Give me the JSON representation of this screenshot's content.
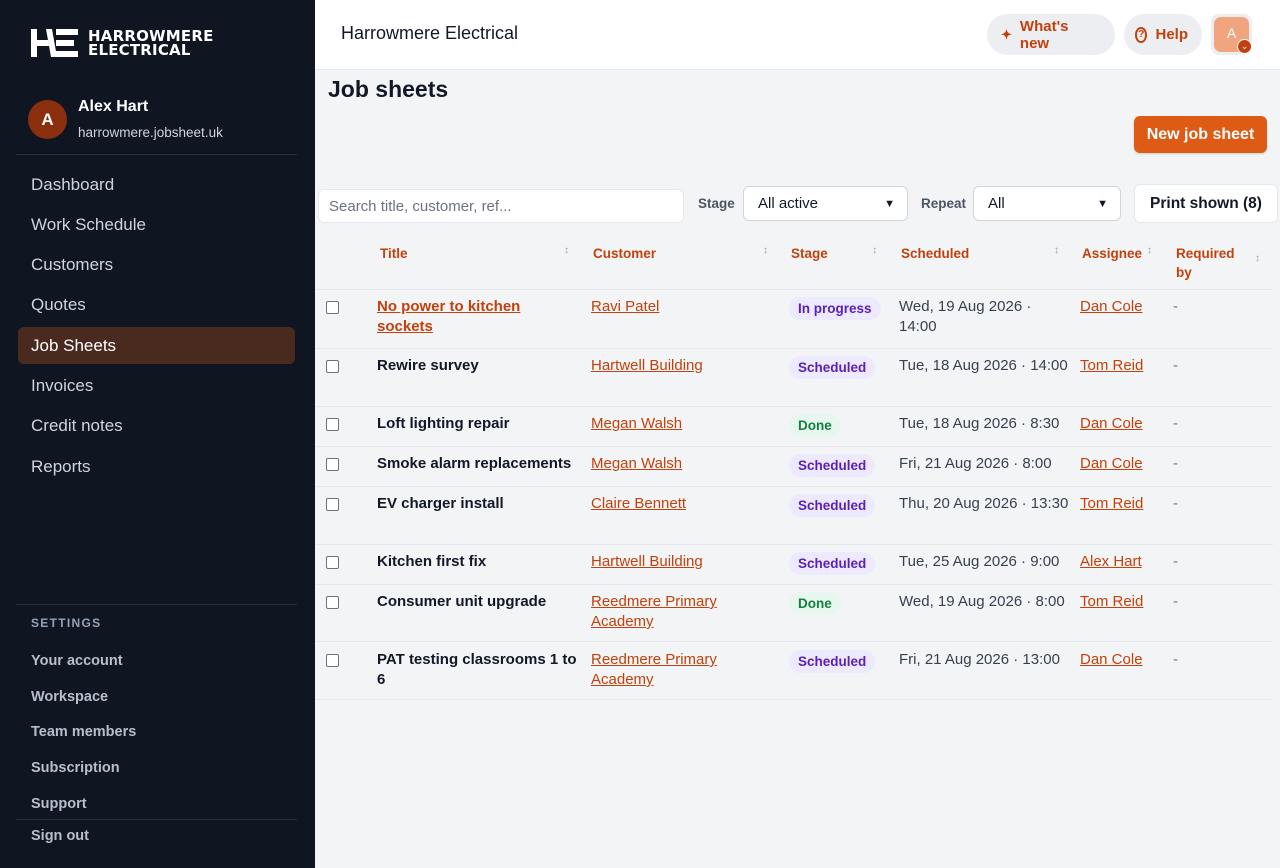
{
  "brand": {
    "line1": "HARROWMERE",
    "line2": "ELECTRICAL",
    "mark": "HE"
  },
  "user": {
    "initial": "A",
    "name": "Alex Hart",
    "domain": "harrowmere.jobsheet.uk"
  },
  "nav": [
    {
      "label": "Dashboard"
    },
    {
      "label": "Work Schedule"
    },
    {
      "label": "Customers"
    },
    {
      "label": "Quotes"
    },
    {
      "label": "Job Sheets",
      "active": true
    },
    {
      "label": "Invoices"
    },
    {
      "label": "Credit notes"
    },
    {
      "label": "Reports"
    }
  ],
  "settings": {
    "heading": "SETTINGS",
    "items": [
      "Your account",
      "Workspace",
      "Team members",
      "Subscription",
      "Support"
    ],
    "signout": "Sign out"
  },
  "topbar": {
    "title": "Harrowmere Electrical",
    "whats_new": "What's new",
    "help": "Help",
    "account_initial": "A"
  },
  "page": {
    "title": "Job sheets",
    "new_button": "New job sheet",
    "search_placeholder": "Search title, customer, ref...",
    "stage_label": "Stage",
    "stage_value": "All active",
    "repeat_label": "Repeat",
    "repeat_value": "All",
    "print_button": "Print shown (8)"
  },
  "table": {
    "columns": [
      "Title",
      "Customer",
      "Stage",
      "Scheduled",
      "Assignee",
      "Required by"
    ],
    "rows": [
      {
        "title": "No power to kitchen sockets",
        "customer": "Ravi Patel",
        "stage": "In progress",
        "scheduled": "Wed, 19 Aug 2026 · 14:00",
        "assignee": "Dan Cole",
        "required": "-"
      },
      {
        "title": "Rewire survey",
        "customer": "Hartwell Building",
        "stage": "Scheduled",
        "scheduled": "Tue, 18 Aug 2026 · 14:00",
        "assignee": "Tom Reid",
        "required": "-"
      },
      {
        "title": "Loft lighting repair",
        "customer": "Megan Walsh",
        "stage": "Done",
        "scheduled": "Tue, 18 Aug 2026 · 8:30",
        "assignee": "Dan Cole",
        "required": "-"
      },
      {
        "title": "Smoke alarm replacements",
        "customer": "Megan Walsh",
        "stage": "Scheduled",
        "scheduled": "Fri, 21 Aug 2026 · 8:00",
        "assignee": "Dan Cole",
        "required": "-"
      },
      {
        "title": "EV charger install",
        "customer": "Claire Bennett",
        "stage": "Scheduled",
        "scheduled": "Thu, 20 Aug 2026 · 13:30",
        "assignee": "Tom Reid",
        "required": "-"
      },
      {
        "title": "Kitchen first fix",
        "customer": "Hartwell Building",
        "stage": "Scheduled",
        "scheduled": "Tue, 25 Aug 2026 · 9:00",
        "assignee": "Alex Hart",
        "required": "-"
      },
      {
        "title": "Consumer unit upgrade",
        "customer": "Reedmere Primary Academy",
        "stage": "Done",
        "scheduled": "Wed, 19 Aug 2026 · 8:00",
        "assignee": "Tom Reid",
        "required": "-"
      },
      {
        "title": "PAT testing classrooms 1 to 6",
        "customer": "Reedmere Primary Academy",
        "stage": "Scheduled",
        "scheduled": "Fri, 21 Aug 2026 · 13:00",
        "assignee": "Dan Cole",
        "required": "-"
      }
    ]
  }
}
